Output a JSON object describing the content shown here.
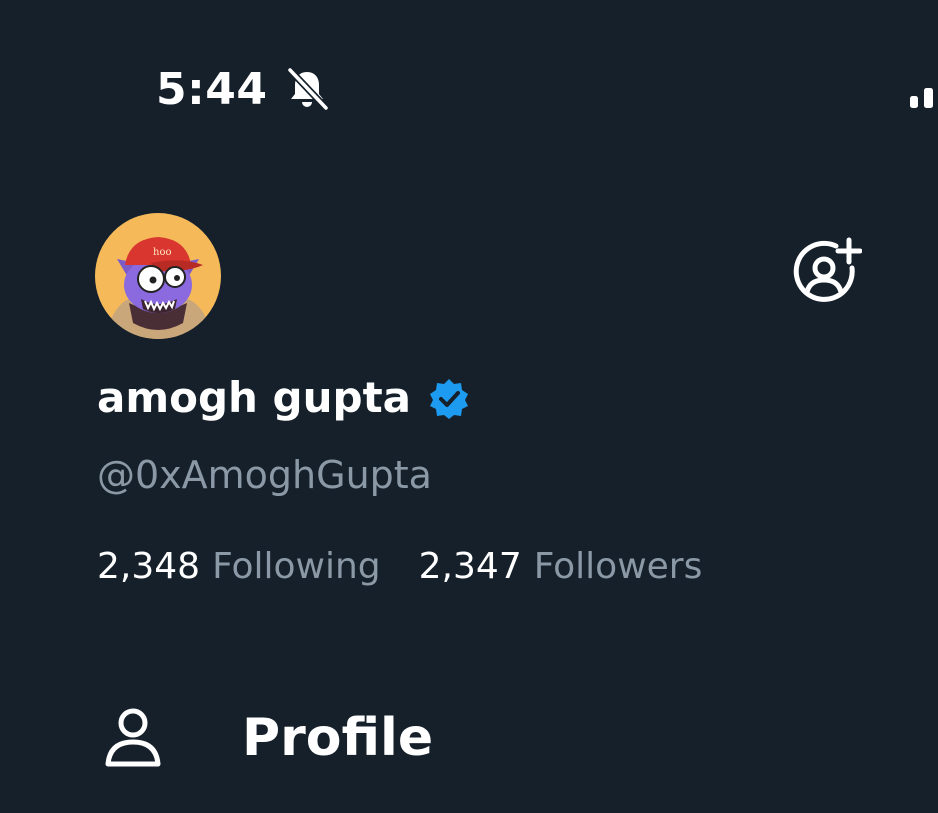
{
  "status_bar": {
    "time": "5:44",
    "bell_icon": "bell-slash-icon",
    "signal_icon": "cellular-signal-icon"
  },
  "account": {
    "avatar_text": "hoo",
    "display_name": "amogh gupta",
    "handle": "@0xAmoghGupta",
    "verified": true,
    "add_account_icon": "add-account-icon"
  },
  "stats": {
    "following_count": "2,348",
    "following_label": "Following",
    "followers_count": "2,347",
    "followers_label": "Followers"
  },
  "menu": {
    "items": [
      {
        "icon": "person-icon",
        "label": "Profile"
      }
    ]
  },
  "colors": {
    "background": "#15202b",
    "text_primary": "#ffffff",
    "text_secondary": "#8b98a5",
    "verified_badge": "#1d9bf0",
    "avatar_bg": "#f5b95a"
  }
}
